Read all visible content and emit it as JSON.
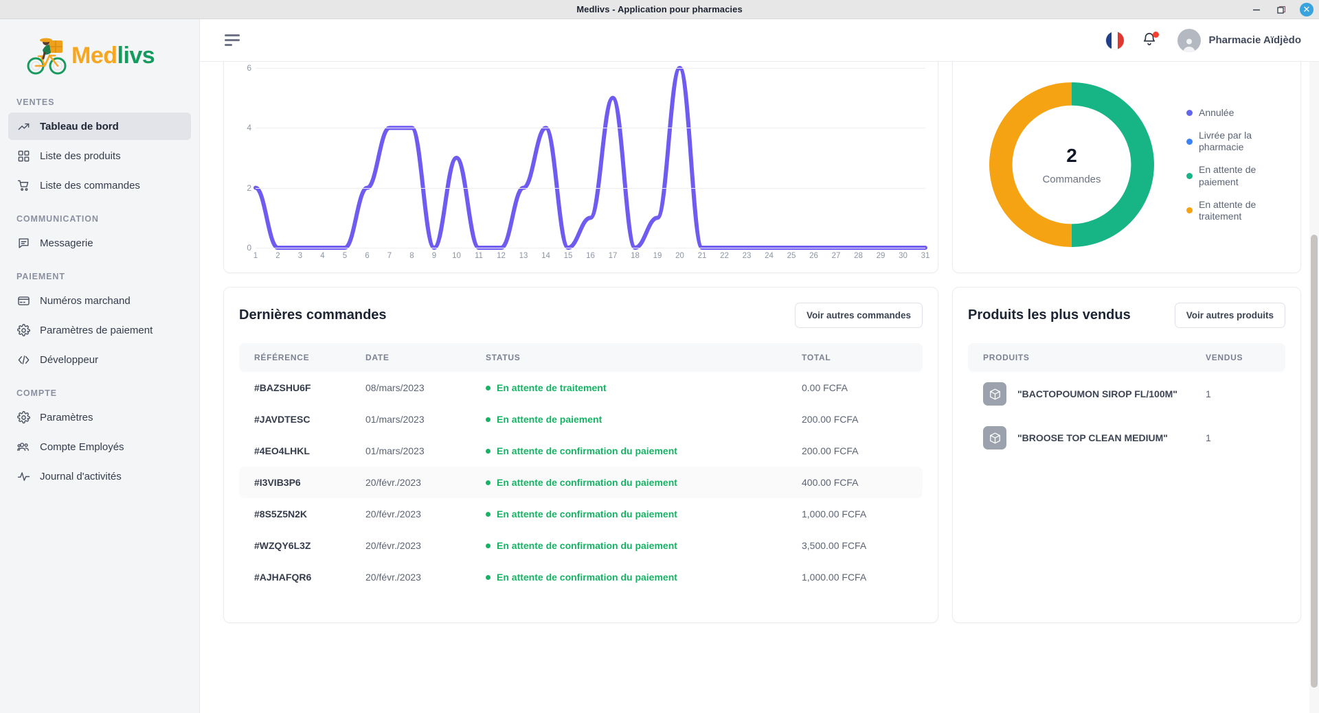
{
  "window": {
    "title": "Medlivs - Application pour pharmacies",
    "minimize_label": "–",
    "maximize_label": "❐",
    "close_label": "✕"
  },
  "brand": {
    "word_first": "Med",
    "word_second": "livs",
    "icon": "cyclist-delivery-icon"
  },
  "sidebar": {
    "sections": [
      {
        "label": "VENTES",
        "items": [
          {
            "label": "Tableau de bord",
            "icon": "trending-up-icon",
            "active": true
          },
          {
            "label": "Liste des produits",
            "icon": "grid-squares-icon",
            "active": false
          },
          {
            "label": "Liste des commandes",
            "icon": "shopping-cart-icon",
            "active": false
          }
        ]
      },
      {
        "label": "COMMUNICATION",
        "items": [
          {
            "label": "Messagerie",
            "icon": "chat-bubble-icon",
            "active": false
          }
        ]
      },
      {
        "label": "PAIEMENT",
        "items": [
          {
            "label": "Numéros marchand",
            "icon": "credit-card-icon",
            "active": false
          },
          {
            "label": "Paramètres de paiement",
            "icon": "gear-icon",
            "active": false
          },
          {
            "label": "Développeur",
            "icon": "code-brackets-icon",
            "active": false
          }
        ]
      },
      {
        "label": "COMPTE",
        "items": [
          {
            "label": "Paramètres",
            "icon": "gear-icon",
            "active": false
          },
          {
            "label": "Compte Employés",
            "icon": "users-group-icon",
            "active": false
          },
          {
            "label": "Journal d'activités",
            "icon": "activity-pulse-icon",
            "active": false
          }
        ]
      }
    ]
  },
  "topbar": {
    "menu_icon": "hamburger-menu-icon",
    "language_icon": "french-flag-icon",
    "notification_icon": "bell-icon",
    "user_name": "Pharmacie Aïdjèdo",
    "avatar_icon": "user-avatar-icon"
  },
  "chart_data": [
    {
      "type": "line",
      "title": "",
      "xlabel": "",
      "ylabel": "",
      "grid": true,
      "ylim": [
        0,
        6
      ],
      "yticks": [
        0,
        2,
        4,
        6
      ],
      "x": [
        1,
        2,
        3,
        4,
        5,
        6,
        7,
        8,
        9,
        10,
        11,
        12,
        13,
        14,
        15,
        16,
        17,
        18,
        19,
        20,
        21,
        22,
        23,
        24,
        25,
        26,
        27,
        28,
        29,
        30,
        31
      ],
      "categories": [
        "1",
        "2",
        "3",
        "4",
        "5",
        "6",
        "7",
        "8",
        "9",
        "10",
        "11",
        "12",
        "13",
        "14",
        "15",
        "16",
        "17",
        "18",
        "19",
        "20",
        "21",
        "22",
        "23",
        "24",
        "25",
        "26",
        "27",
        "28",
        "29",
        "30",
        "31"
      ],
      "values": [
        2,
        0,
        0,
        0,
        0,
        2,
        4,
        4,
        0,
        3,
        0,
        0,
        2,
        4,
        0,
        1,
        5,
        0,
        1,
        6,
        0,
        0,
        0,
        0,
        0,
        0,
        0,
        0,
        0,
        0,
        0
      ],
      "series_color": "#6f5bf0",
      "legend": []
    },
    {
      "type": "pie",
      "subtype": "donut",
      "center_value": "2",
      "center_label": "Commandes",
      "labels": [
        "Annulée",
        "Livrée par la pharmacie",
        "En attente de paiement",
        "En attente de traitement"
      ],
      "values": [
        0,
        0,
        1,
        1
      ],
      "colors": [
        "#6366e8",
        "#3b82f6",
        "#17b486",
        "#f5a312"
      ],
      "legend_position": "right"
    }
  ],
  "orders_panel": {
    "title": "Dernières commandes",
    "action_label": "Voir autres commandes",
    "columns": [
      "RÉFÉRENCE",
      "DATE",
      "STATUS",
      "TOTAL"
    ],
    "rows": [
      {
        "reference": "#BAZSHU6F",
        "date": "08/mars/2023",
        "status": "En attente de traitement",
        "total": "0.00 FCFA",
        "highlight": false
      },
      {
        "reference": "#JAVDTESC",
        "date": "01/mars/2023",
        "status": "En attente de paiement",
        "total": "200.00 FCFA",
        "highlight": false
      },
      {
        "reference": "#4EO4LHKL",
        "date": "01/mars/2023",
        "status": "En attente de confirmation du paiement",
        "total": "200.00 FCFA",
        "highlight": false
      },
      {
        "reference": "#I3VIB3P6",
        "date": "20/févr./2023",
        "status": "En attente de confirmation du paiement",
        "total": "400.00 FCFA",
        "highlight": true
      },
      {
        "reference": "#8S5Z5N2K",
        "date": "20/févr./2023",
        "status": "En attente de confirmation du paiement",
        "total": "1,000.00 FCFA",
        "highlight": false
      },
      {
        "reference": "#WZQY6L3Z",
        "date": "20/févr./2023",
        "status": "En attente de confirmation du paiement",
        "total": "3,500.00 FCFA",
        "highlight": false
      },
      {
        "reference": "#AJHAFQR6",
        "date": "20/févr./2023",
        "status": "En attente de confirmation du paiement",
        "total": "1,000.00 FCFA",
        "highlight": false
      }
    ]
  },
  "products_panel": {
    "title": "Produits les plus vendus",
    "action_label": "Voir autres produits",
    "columns": [
      "PRODUITS",
      "VENDUS"
    ],
    "rows": [
      {
        "name": "\"BACTOPOUMON SIROP FL/100M\"",
        "sold": "1",
        "icon": "package-box-icon"
      },
      {
        "name": "\"BROOSE TOP CLEAN MEDIUM\"",
        "sold": "1",
        "icon": "package-box-icon"
      }
    ]
  },
  "colors": {
    "accent_orange": "#f5a623",
    "accent_green": "#179a5e",
    "line_purple": "#6f5bf0",
    "status_green": "#16b364",
    "donut_green": "#17b486",
    "donut_orange": "#f5a312"
  }
}
